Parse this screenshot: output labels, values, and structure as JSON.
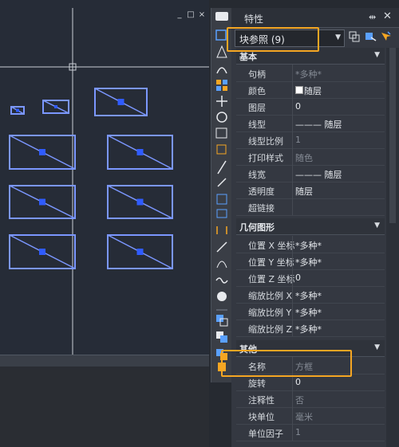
{
  "canvas": {
    "controls": [
      "_",
      "□",
      "×"
    ]
  },
  "panel": {
    "title": "特性",
    "pin_icon": "pin-icon",
    "close_label": "✕",
    "selector_value": "块参照 (9)"
  },
  "sections": {
    "basic": "基本",
    "geometry": "几何图形",
    "other": "其他"
  },
  "basic_rows": [
    {
      "label": "句柄",
      "value": "*多种*"
    },
    {
      "label": "颜色",
      "value": "随层"
    },
    {
      "label": "图层",
      "value": "0"
    },
    {
      "label": "线型",
      "value": "——— 随层"
    },
    {
      "label": "线型比例",
      "value": "1"
    },
    {
      "label": "打印样式",
      "value": "随色"
    },
    {
      "label": "线宽",
      "value": "——— 随层"
    },
    {
      "label": "透明度",
      "value": "随层"
    },
    {
      "label": "超链接",
      "value": ""
    }
  ],
  "geometry_rows": [
    {
      "label": "位置 X 坐标",
      "value": "*多种*"
    },
    {
      "label": "位置 Y 坐标",
      "value": "*多种*"
    },
    {
      "label": "位置 Z 坐标",
      "value": "0"
    },
    {
      "label": "缩放比例 X",
      "value": "*多种*"
    },
    {
      "label": "缩放比例 Y",
      "value": "*多种*"
    },
    {
      "label": "缩放比例 Z",
      "value": "*多种*"
    }
  ],
  "other_rows": [
    {
      "label": "名称",
      "value": "方框"
    },
    {
      "label": "旋转",
      "value": "0"
    },
    {
      "label": "注释性",
      "value": "否"
    },
    {
      "label": "块单位",
      "value": "毫米"
    },
    {
      "label": "单位因子",
      "value": "1"
    }
  ],
  "colors": {
    "accent_orange": "#f5a623",
    "block_blue": "#6d8dff",
    "canvas_bg": "#262c37"
  }
}
